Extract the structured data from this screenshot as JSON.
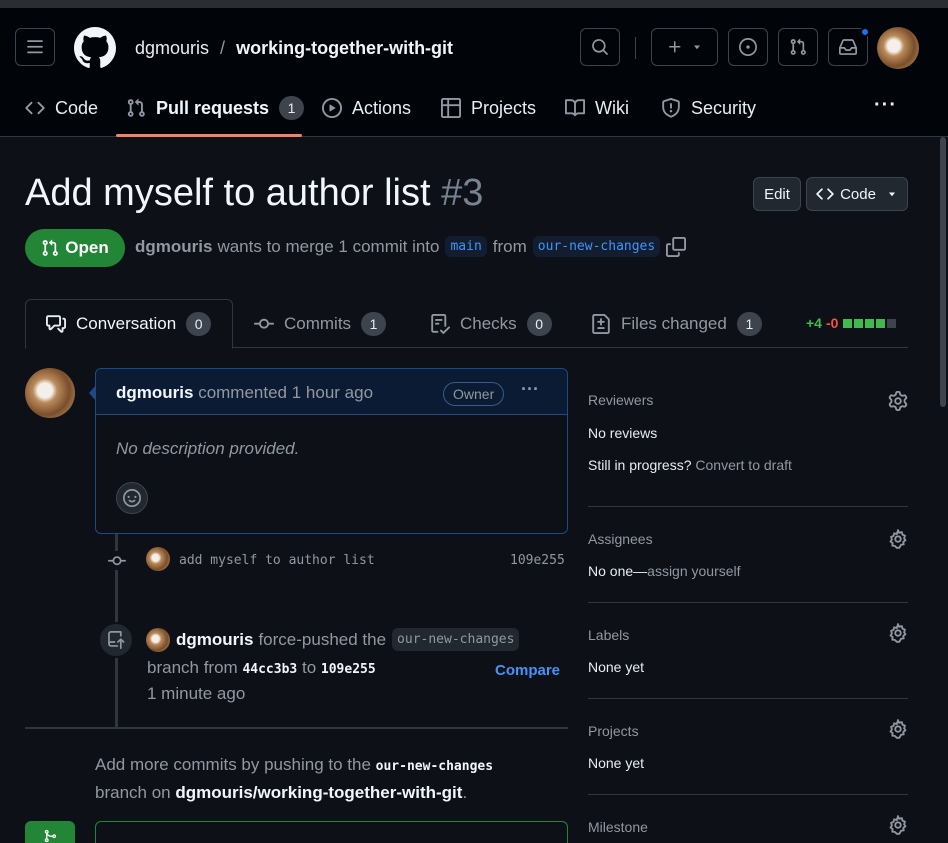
{
  "header": {
    "owner": "dgmouris",
    "separator": "/",
    "repo": "working-together-with-git"
  },
  "nav": {
    "tabs": [
      {
        "label": "Code",
        "icon": "code-icon"
      },
      {
        "label": "Pull requests",
        "icon": "pull-request-icon",
        "count": "1"
      },
      {
        "label": "Actions",
        "icon": "play-icon"
      },
      {
        "label": "Projects",
        "icon": "table-icon"
      },
      {
        "label": "Wiki",
        "icon": "book-icon"
      },
      {
        "label": "Security",
        "icon": "shield-icon"
      }
    ],
    "more": "···"
  },
  "pr": {
    "title": "Add myself to author list",
    "number": "#3",
    "edit_label": "Edit",
    "code_label": "Code",
    "status": "Open",
    "author": "dgmouris",
    "merge_text": "wants to merge 1 commit into",
    "base_branch": "main",
    "from_text": "from",
    "head_branch": "our-new-changes"
  },
  "tabs": [
    {
      "label": "Conversation",
      "count": "0"
    },
    {
      "label": "Commits",
      "count": "1"
    },
    {
      "label": "Checks",
      "count": "0"
    },
    {
      "label": "Files changed",
      "count": "1"
    }
  ],
  "diffstat": {
    "additions": "+4",
    "deletions": "-0"
  },
  "comment": {
    "author": "dgmouris",
    "action": "commented 1 hour ago",
    "badge": "Owner",
    "body": "No description provided."
  },
  "commit": {
    "message": "add myself to author list",
    "sha": "109e255"
  },
  "forcepush": {
    "author": "dgmouris",
    "action": "force-pushed the",
    "branch": "our-new-changes",
    "branch_from": "branch from",
    "old_sha": "44cc3b3",
    "to": "to",
    "new_sha": "109e255",
    "compare": "Compare",
    "time": "1 minute ago"
  },
  "footer": {
    "text1": "Add more commits by pushing to the",
    "branch": "our-new-changes",
    "text2": "branch on",
    "repo": "dgmouris/working-together-with-git",
    "period": "."
  },
  "sidebar": {
    "reviewers": {
      "title": "Reviewers",
      "value": "No reviews",
      "progress_q": "Still in progress?",
      "draft_link": "Convert to draft"
    },
    "assignees": {
      "title": "Assignees",
      "value": "No one—",
      "link": "assign yourself"
    },
    "labels": {
      "title": "Labels",
      "value": "None yet"
    },
    "projects": {
      "title": "Projects",
      "value": "None yet"
    },
    "milestone": {
      "title": "Milestone"
    }
  },
  "colors": {
    "accent": "#4493f8",
    "open_green": "#238636",
    "additions": "#3fb950",
    "deletions": "#f85149",
    "background": "#0d1117"
  }
}
